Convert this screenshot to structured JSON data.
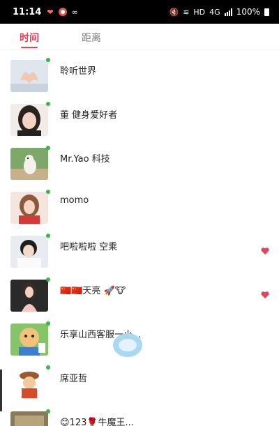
{
  "status_bar": {
    "time": "11:14",
    "network": "4G",
    "battery": "100%",
    "icons": [
      "heart-notification-icon",
      "weibo-icon",
      "link-icon",
      "mute-icon",
      "wifi-icon",
      "hd-icon",
      "signal-icon",
      "battery-icon"
    ]
  },
  "tabs": [
    {
      "label": "时间",
      "active": true
    },
    {
      "label": "距离",
      "active": false
    }
  ],
  "accent_color": "#e0455d",
  "online_color": "#3ab54a",
  "users": [
    {
      "name": "聆听世界",
      "online": true,
      "liked": false
    },
    {
      "name": "董  健身爱好者",
      "online": true,
      "liked": false
    },
    {
      "name": "Mr.Yao  科技",
      "online": true,
      "liked": false
    },
    {
      "name": "momo",
      "online": true,
      "liked": false
    },
    {
      "name": "吧啦啦啦  空乘",
      "online": true,
      "liked": true
    },
    {
      "name": "🇨🇳🇨🇳天亮 🚀🐮",
      "online": true,
      "liked": true
    },
    {
      "name": "乐享山西客服一小...",
      "online": true,
      "liked": false
    },
    {
      "name": "席亚哲",
      "online": true,
      "liked": false
    },
    {
      "name": "😊123🌹牛魔王...",
      "online": true,
      "liked": false
    }
  ]
}
